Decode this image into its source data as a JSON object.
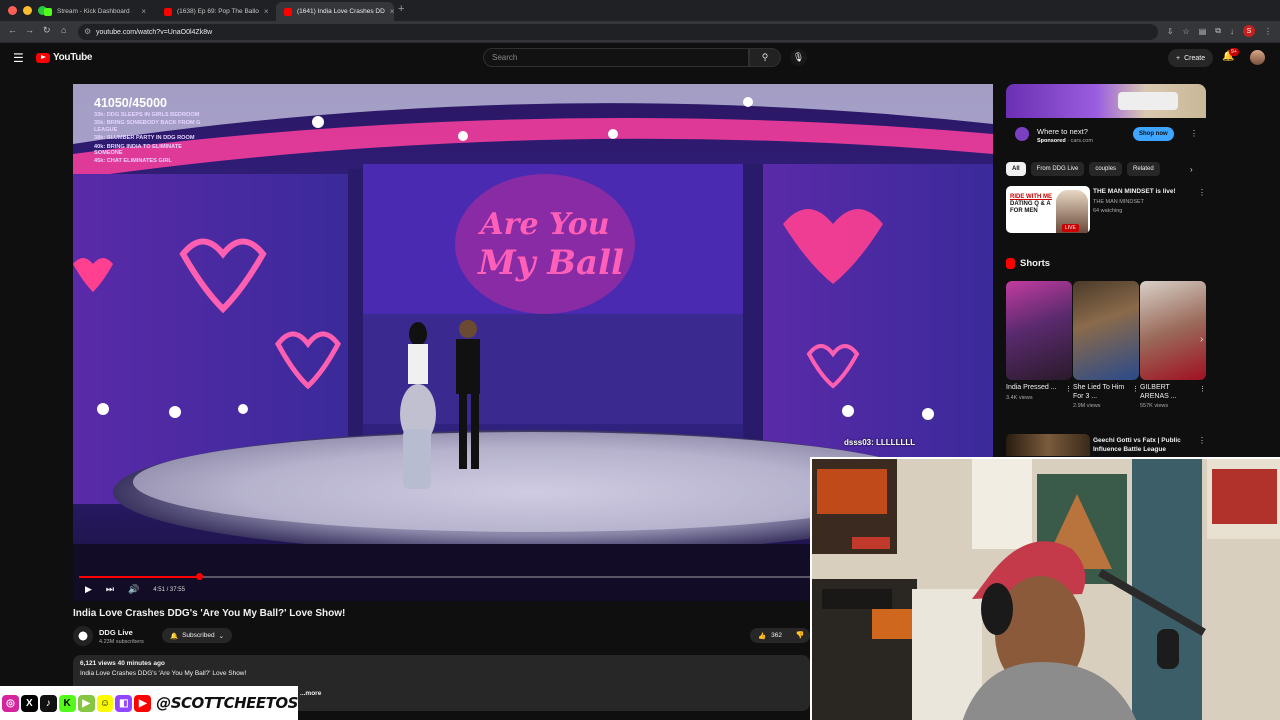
{
  "browser": {
    "tabs": [
      {
        "title": "Stream - Kick Dashboard",
        "fav_color": "#53fc18"
      },
      {
        "title": "(1638) Ep 69: Pop The Ballo",
        "fav_color": "#ff0000"
      },
      {
        "title": "(1641) India Love Crashes DD",
        "fav_color": "#ff0000"
      }
    ],
    "new_tab": "+",
    "url": "youtube.com/watch?v=UnaO0l4Zk8w",
    "profile_letter": "S"
  },
  "youtube": {
    "logo_text": "YouTube",
    "search_placeholder": "Search",
    "create_label": "Create",
    "notifications": "9+"
  },
  "video": {
    "overlay_count": "41050/45000",
    "overlay_goals": [
      "33k: DDG SLEEPS IN GIRLS BEDROOM",
      "35k: BRING SOMEBODY BACK FROM G LEAGUE",
      "38k: SLUMBER PARTY IN DDG ROOM",
      "40k: BRING INDIA TO ELIMINATE SOMEONE",
      "45k: CHAT ELIMINATES GIRL"
    ],
    "chat_overlay": "dsss03: LLLLLLLL",
    "progress": 0.132,
    "time": "4:51 / 37:55",
    "title": "India Love Crashes DDG's 'Are You My Ball?' Love Show!",
    "channel": "DDG Live",
    "subscribers": "4.23M subscribers",
    "subscribe_label": "Subscribed",
    "likes": "362",
    "desc_stats": "6,121 views  40 minutes ago",
    "desc_text": "India Love Crashes DDG's 'Are You My Ball?' Love Show!",
    "desc_more": "...more"
  },
  "sidebar": {
    "ad_headline": "Where to next?",
    "ad_sponsored": "Sponsored",
    "ad_domain": "cars.com",
    "ad_button": "Shop now",
    "chips": [
      "All",
      "From DDG Live",
      "couples",
      "Related"
    ],
    "rec1": {
      "thumb_text_a": "RIDE WITH ME",
      "thumb_text_b": "DATING Q & A FOR MEN",
      "live_badge": "LIVE",
      "title": "THE MAN MINDSET  is live!",
      "channel": "THE MAN MINDSET",
      "watching": "64 watching"
    },
    "shorts_header": "Shorts",
    "shorts": [
      {
        "title": "India Pressed ...",
        "views": "3.4K views",
        "pic": "linear-gradient(160deg,#c23ca0,#5a2a6e 45%,#2a1a2a)"
      },
      {
        "title": "She Lied To Him For 3 ...",
        "views": "2.9M views",
        "pic": "linear-gradient(160deg,#4a3a2a,#8a6a4a 40%,#2a4a8a)"
      },
      {
        "title": "GILBERT ARENAS ...",
        "views": "557K views",
        "pic": "linear-gradient(160deg,#d8d0c8,#9a6a5a 50%,#a01020)"
      }
    ],
    "rec2_title": "Geechi Gotti vs Fatx | Public Influence Battle League"
  },
  "social": {
    "handle": "@SCOTTCHEETOS",
    "icons": [
      {
        "name": "instagram-icon",
        "glyph": "◎",
        "color": "#d6249f"
      },
      {
        "name": "x-icon",
        "glyph": "X",
        "color": "#000000"
      },
      {
        "name": "tiktok-icon",
        "glyph": "♪",
        "color": "#111111"
      },
      {
        "name": "kick-icon",
        "glyph": "K",
        "color": "#53fc18"
      },
      {
        "name": "rumble-icon",
        "glyph": "▶",
        "color": "#85c742"
      },
      {
        "name": "snapchat-icon",
        "glyph": "☺",
        "color": "#fffc00"
      },
      {
        "name": "twitch-icon",
        "glyph": "◧",
        "color": "#9146ff"
      },
      {
        "name": "youtube-icon",
        "glyph": "▶",
        "color": "#ff0000"
      }
    ]
  },
  "colors": {
    "accent": "#ff0000",
    "background": "#0f0f0f",
    "link": "#3ea6ff"
  }
}
